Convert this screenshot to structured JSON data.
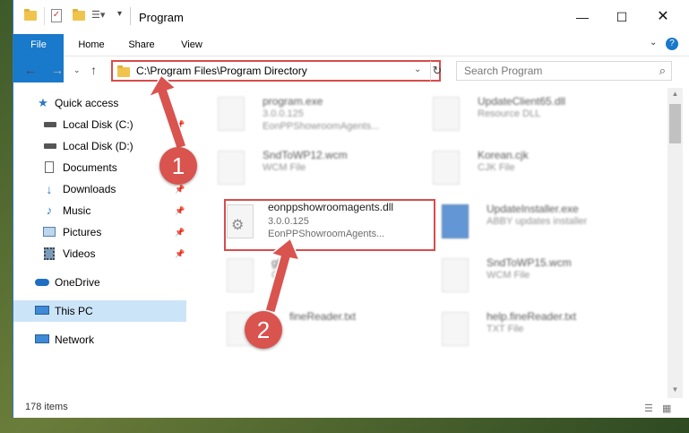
{
  "window": {
    "title": "Program"
  },
  "ribbon": {
    "tabs": [
      "File",
      "Home",
      "Share",
      "View"
    ]
  },
  "address": {
    "path": "C:\\Program Files\\Program Directory"
  },
  "search": {
    "placeholder": "Search Program"
  },
  "sidebar": {
    "items": [
      {
        "label": "Quick access",
        "icon": "star-icon"
      },
      {
        "label": "Local Disk (C:)",
        "icon": "drive-icon"
      },
      {
        "label": "Local Disk (D:)",
        "icon": "drive-icon"
      },
      {
        "label": "Documents",
        "icon": "documents-icon"
      },
      {
        "label": "Downloads",
        "icon": "download-arrow-icon"
      },
      {
        "label": "Music",
        "icon": "music-note-icon"
      },
      {
        "label": "Pictures",
        "icon": "pictures-icon"
      },
      {
        "label": "Videos",
        "icon": "film-icon"
      },
      {
        "label": "OneDrive",
        "icon": "cloud-icon"
      },
      {
        "label": "This PC",
        "icon": "monitor-icon"
      },
      {
        "label": "Network",
        "icon": "network-icon"
      }
    ]
  },
  "files": [
    {
      "name": "program.exe",
      "line2": "3.0.0.125",
      "line3": "EonPPShowroomAgents..."
    },
    {
      "name": "UpdateClient65.dll",
      "line2": "Resource DLL",
      "line3": ""
    },
    {
      "name": "SndToWP12.wcm",
      "line2": "WCM File",
      "line3": ""
    },
    {
      "name": "Korean.cjk",
      "line2": "CJK File",
      "line3": ""
    },
    {
      "name": "eonppshowroomagents.dll",
      "line2": "3.0.0.125",
      "line3": "EonPPShowroomAgents..."
    },
    {
      "name": "UpdateInstaller.exe",
      "line2": "ABBY updates installer",
      "line3": ""
    },
    {
      "name": "gb",
      "line2": "CK",
      "line3": ""
    },
    {
      "name": "SndToWP15.wcm",
      "line2": "WCM File",
      "line3": ""
    },
    {
      "name": "fineReader.txt",
      "line2": "",
      "line3": ""
    },
    {
      "name": "help.fineReader.txt",
      "line2": "TXT File",
      "line3": ""
    }
  ],
  "status": {
    "item_count": "178 items"
  },
  "callouts": {
    "one": "1",
    "two": "2"
  },
  "colors": {
    "accent": "#1979ca",
    "callout": "#d9534f",
    "highlight_border": "#d84c4c"
  }
}
